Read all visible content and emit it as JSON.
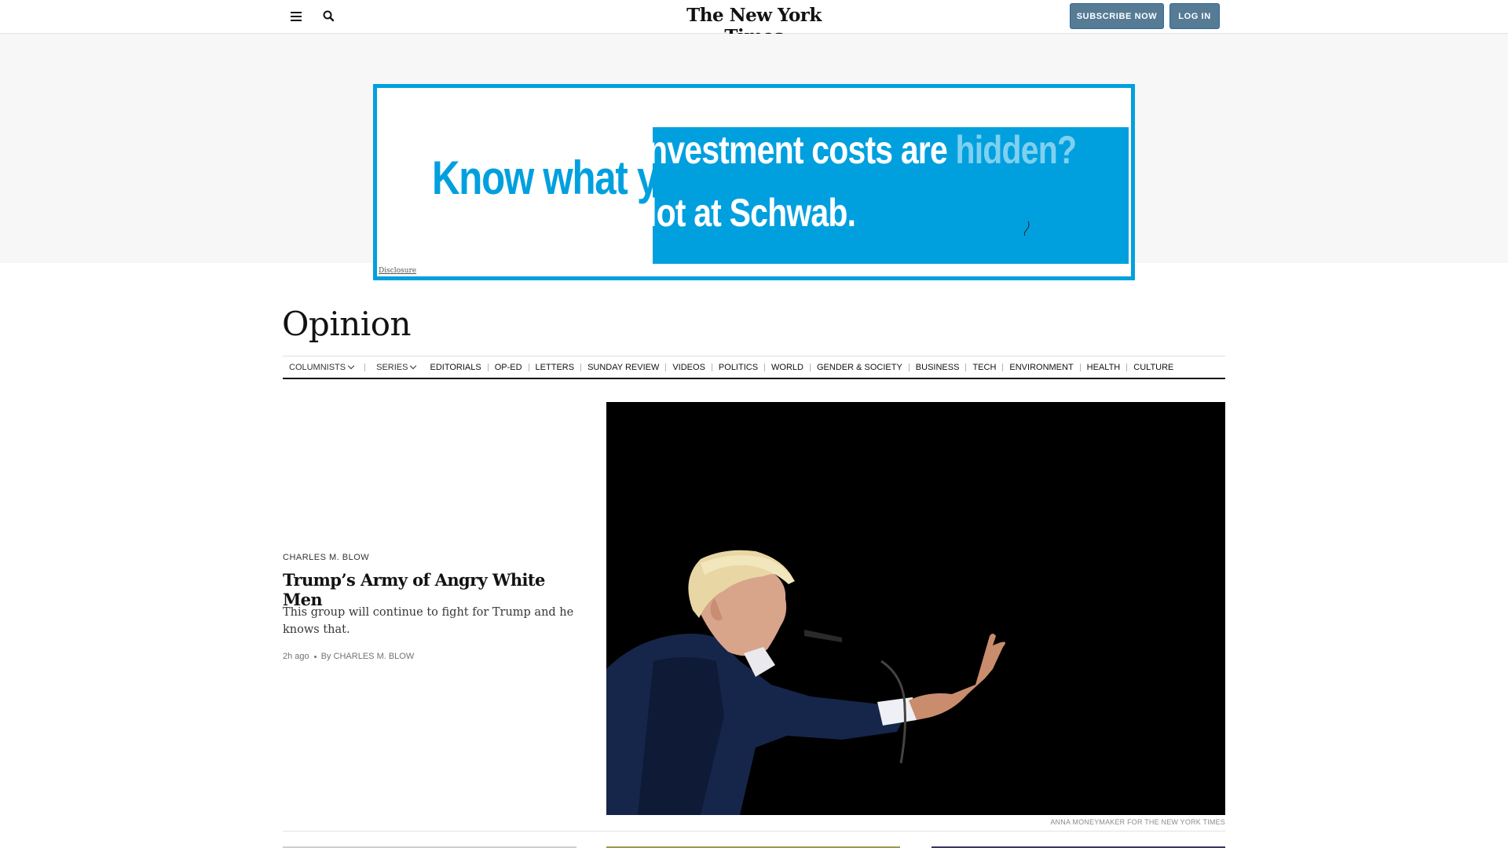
{
  "header": {
    "logo": "The New York Times",
    "subscribe_label": "SUBSCRIBE NOW",
    "login_label": "LOG IN"
  },
  "ad": {
    "headline_left": "Know what y",
    "overlay_line1_main": "nvestment costs are ",
    "overlay_line1_faded": "hidden?",
    "overlay_line2": "lot at Schwab.",
    "disclosure": "Disclosure",
    "brand_color": "#00a0df"
  },
  "section": {
    "title": "Opinion",
    "nav": {
      "columnists": "COLUMNISTS",
      "series": "SERIES",
      "items": [
        "EDITORIALS",
        "OP-ED",
        "LETTERS",
        "SUNDAY REVIEW",
        "VIDEOS",
        "POLITICS",
        "WORLD",
        "GENDER & SOCIETY",
        "BUSINESS",
        "TECH",
        "ENVIRONMENT",
        "HEALTH",
        "CULTURE"
      ]
    }
  },
  "lead": {
    "kicker": "CHARLES M. BLOW",
    "headline": "Trump’s Army of Angry White Men",
    "summary": "This group will continue to fight for Trump and he knows that.",
    "time": "2h ago",
    "byline": "By CHARLES M. BLOW",
    "photo_credit": "ANNA MONEYMAKER FOR THE NEW YORK TIMES"
  }
}
